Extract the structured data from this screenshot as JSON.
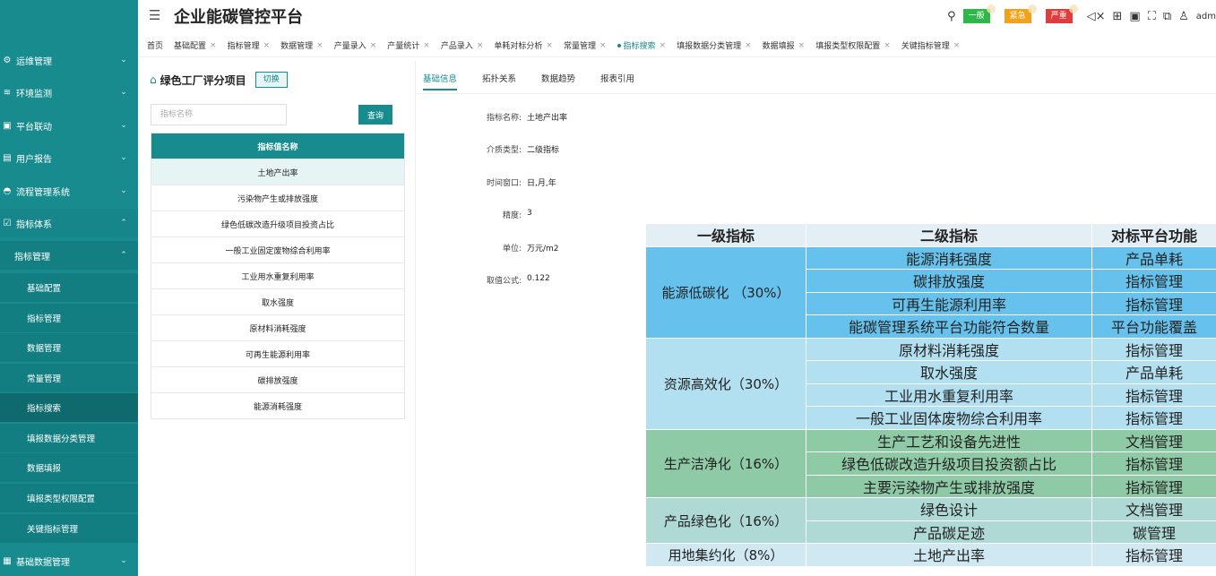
{
  "app": {
    "title": "企业能碳管控平台",
    "user": "adm"
  },
  "header": {
    "badges": [
      {
        "label": "一般",
        "color": "#2eb84a"
      },
      {
        "label": "紧急",
        "color": "#f4a11a"
      },
      {
        "label": "严重",
        "color": "#e23b3b"
      }
    ]
  },
  "sidebar": {
    "items": [
      {
        "icon": "⚙",
        "label": "运维管理",
        "chevron": "⌄"
      },
      {
        "icon": "≋",
        "label": "环境监测",
        "chevron": "⌄"
      },
      {
        "icon": "▣",
        "label": "平台联动",
        "chevron": "⌄"
      },
      {
        "icon": "▤",
        "label": "用户报告",
        "chevron": "⌄"
      },
      {
        "icon": "◓",
        "label": "流程管理系统",
        "chevron": "⌄"
      },
      {
        "icon": "☑",
        "label": "指标体系",
        "chevron": "⌃"
      },
      {
        "label": "指标管理",
        "chevron": "⌃"
      },
      {
        "label": "基础配置"
      },
      {
        "label": "指标管理"
      },
      {
        "label": "数据管理"
      },
      {
        "label": "常量管理"
      },
      {
        "label": "指标搜索"
      },
      {
        "label": "填报数据分类管理"
      },
      {
        "label": "数据填报"
      },
      {
        "label": "填报类型权限配置"
      },
      {
        "label": "关键指标管理"
      },
      {
        "icon": "▦",
        "label": "基础数据管理",
        "chevron": "⌄"
      }
    ]
  },
  "tabs": [
    "首页",
    "基础配置",
    "指标管理",
    "数据管理",
    "产量录入",
    "产量统计",
    "产品录入",
    "单耗对标分析",
    "常量管理",
    "指标搜索",
    "填报数据分类管理",
    "数据填报",
    "填报类型权限配置",
    "关键指标管理"
  ],
  "tab_close": "×",
  "left_panel": {
    "title": "绿色工厂评分项目",
    "switch_label": "切换",
    "search_placeholder": "指标名称",
    "query_label": "查询",
    "column_header": "指标值名称",
    "rows": [
      "土地产出率",
      "污染物产生或排放强度",
      "绿色低碳改造升级项目投资占比",
      "一般工业固定废物综合利用率",
      "工业用水重复利用率",
      "取水强度",
      "原材料消耗强度",
      "可再生能源利用率",
      "碳排放强度",
      "能源消耗强度"
    ]
  },
  "detail": {
    "tabs": [
      "基础信息",
      "拓扑关系",
      "数据趋势",
      "报表引用"
    ],
    "fields": [
      {
        "label": "指标名称:",
        "value": "土地产出率"
      },
      {
        "label": "介质类型:",
        "value": "二级指标"
      },
      {
        "label": "时间窗口:",
        "value": "日,月,年"
      },
      {
        "label": "精度:",
        "value": "3"
      },
      {
        "label": "单位:",
        "value": "万元/m2"
      },
      {
        "label": "取值公式:",
        "value": "0.122"
      }
    ]
  },
  "overlay_table": {
    "headers": [
      "一级指标",
      "二级指标",
      "对标平台功能"
    ],
    "groups": [
      {
        "name": "能源低碳化 （30%）",
        "rows": [
          [
            "能源消耗强度",
            "产品单耗"
          ],
          [
            "碳排放强度",
            "指标管理"
          ],
          [
            "可再生能源利用率",
            "指标管理"
          ],
          [
            "能碳管理系统平台功能符合数量",
            "平台功能覆盖"
          ]
        ]
      },
      {
        "name": "资源高效化（30%）",
        "rows": [
          [
            "原材料消耗强度",
            "指标管理"
          ],
          [
            "取水强度",
            "产品单耗"
          ],
          [
            "工业用水重复利用率",
            "指标管理"
          ],
          [
            "一般工业固体废物综合利用率",
            "指标管理"
          ]
        ]
      },
      {
        "name": "生产洁净化（16%）",
        "rows": [
          [
            "生产工艺和设备先进性",
            "文档管理"
          ],
          [
            "绿色低碳改造升级项目投资额占比",
            "指标管理"
          ],
          [
            "主要污染物产生或排放强度",
            "指标管理"
          ]
        ]
      },
      {
        "name": "产品绿色化（16%）",
        "rows": [
          [
            "绿色设计",
            "文档管理"
          ],
          [
            "产品碳足迹",
            "碳管理"
          ]
        ]
      },
      {
        "name": "用地集约化（8%）",
        "rows": [
          [
            "土地产出率",
            "指标管理"
          ]
        ]
      }
    ]
  }
}
